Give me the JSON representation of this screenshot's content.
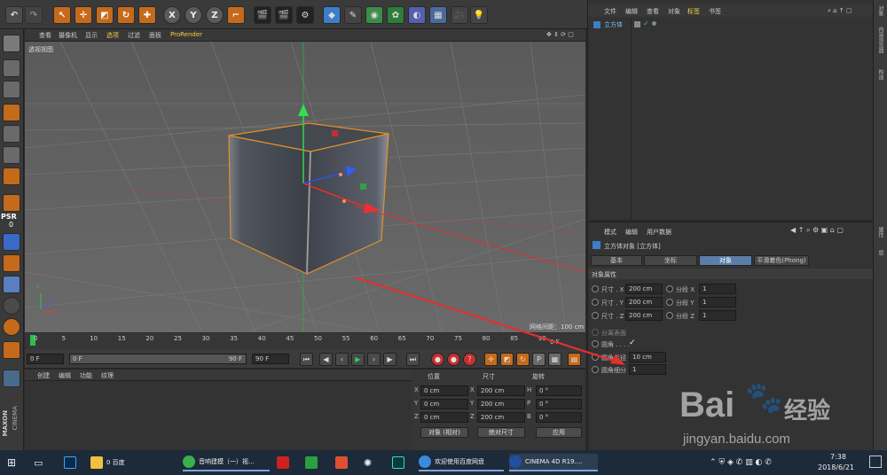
{
  "toolbar": {
    "axis_x": "X",
    "axis_y": "Y",
    "axis_z": "Z"
  },
  "viewport": {
    "menu": [
      "查看",
      "摄像机",
      "显示",
      "选项",
      "过滤",
      "面板",
      "ProRender"
    ],
    "label": "透视视图",
    "grid_info": "网格间距：100 cm",
    "axes": {
      "x": "X",
      "y": "Y",
      "z": "Z"
    }
  },
  "leftbar": {
    "psr": "PSR",
    "psr_value": "0",
    "maxon": "MAXON",
    "cinema": "CINEMA"
  },
  "timeline": {
    "ticks": [
      "0",
      "5",
      "10",
      "15",
      "20",
      "25",
      "30",
      "35",
      "40",
      "45",
      "50",
      "55",
      "60",
      "65",
      "70",
      "75",
      "80",
      "85",
      "90"
    ],
    "end_label": "0 F"
  },
  "playbar": {
    "current": "0 F",
    "range_start": "0 F",
    "range_end": "90 F",
    "max": "90 F"
  },
  "material": {
    "menu": [
      "创建",
      "编辑",
      "功能",
      "纹理"
    ]
  },
  "coordinates": {
    "headers": [
      "位置",
      "尺寸",
      "旋转"
    ],
    "rows": [
      {
        "axis": "X",
        "pos": "0 cm",
        "size": "200 cm",
        "rot_axis": "H",
        "rot": "0 °"
      },
      {
        "axis": "Y",
        "pos": "0 cm",
        "size": "200 cm",
        "rot_axis": "P",
        "rot": "0 °"
      },
      {
        "axis": "Z",
        "pos": "0 cm",
        "size": "200 cm",
        "rot_axis": "B",
        "rot": "0 °"
      }
    ],
    "mode": "对象 (相对)",
    "size_mode": "绝对尺寸",
    "apply": "应用"
  },
  "object_manager": {
    "menu": [
      "文件",
      "编辑",
      "查看",
      "对象",
      "标签",
      "书签"
    ],
    "objects": [
      {
        "name": "立方体"
      }
    ]
  },
  "attributes": {
    "menu": [
      "模式",
      "编辑",
      "用户数据"
    ],
    "title": "立方体对象 [立方体]",
    "tabs": [
      "基本",
      "坐标",
      "对象",
      "平滑着色(Phong)"
    ],
    "active_tab": "对象",
    "section": "对象属性",
    "props": [
      {
        "label": "尺寸 . X",
        "value": "200 cm",
        "seg_label": "分段 X",
        "seg": "1"
      },
      {
        "label": "尺寸 . Y",
        "value": "200 cm",
        "seg_label": "分段 Y",
        "seg": "1"
      },
      {
        "label": "尺寸 . Z",
        "value": "200 cm",
        "seg_label": "分段 Z",
        "seg": "1"
      }
    ],
    "separate": "分离表面",
    "fillet": "圆角 . . . .",
    "fillet_radius_label": "圆角半径",
    "fillet_radius": "10 cm",
    "fillet_sub_label": "圆角细分",
    "fillet_sub": "1"
  },
  "right_strip": [
    "对象",
    "内容浏览器",
    "构造",
    "属性",
    "层"
  ],
  "taskbar": {
    "items": [
      "0 百度",
      "音响建模（一）视...",
      "欢迎使用百度网盘",
      "CINEMA 4D R19...."
    ],
    "time": "7:38",
    "date": "2018/6/21"
  },
  "watermark": {
    "brand": "Bai",
    "brand2": "经验",
    "url": "jingyan.baidu.com"
  },
  "colors": {
    "accent": "#c56a1a",
    "selection": "#f0a030",
    "tab_active": "#5a7ea8",
    "arrow": "#e03030"
  }
}
